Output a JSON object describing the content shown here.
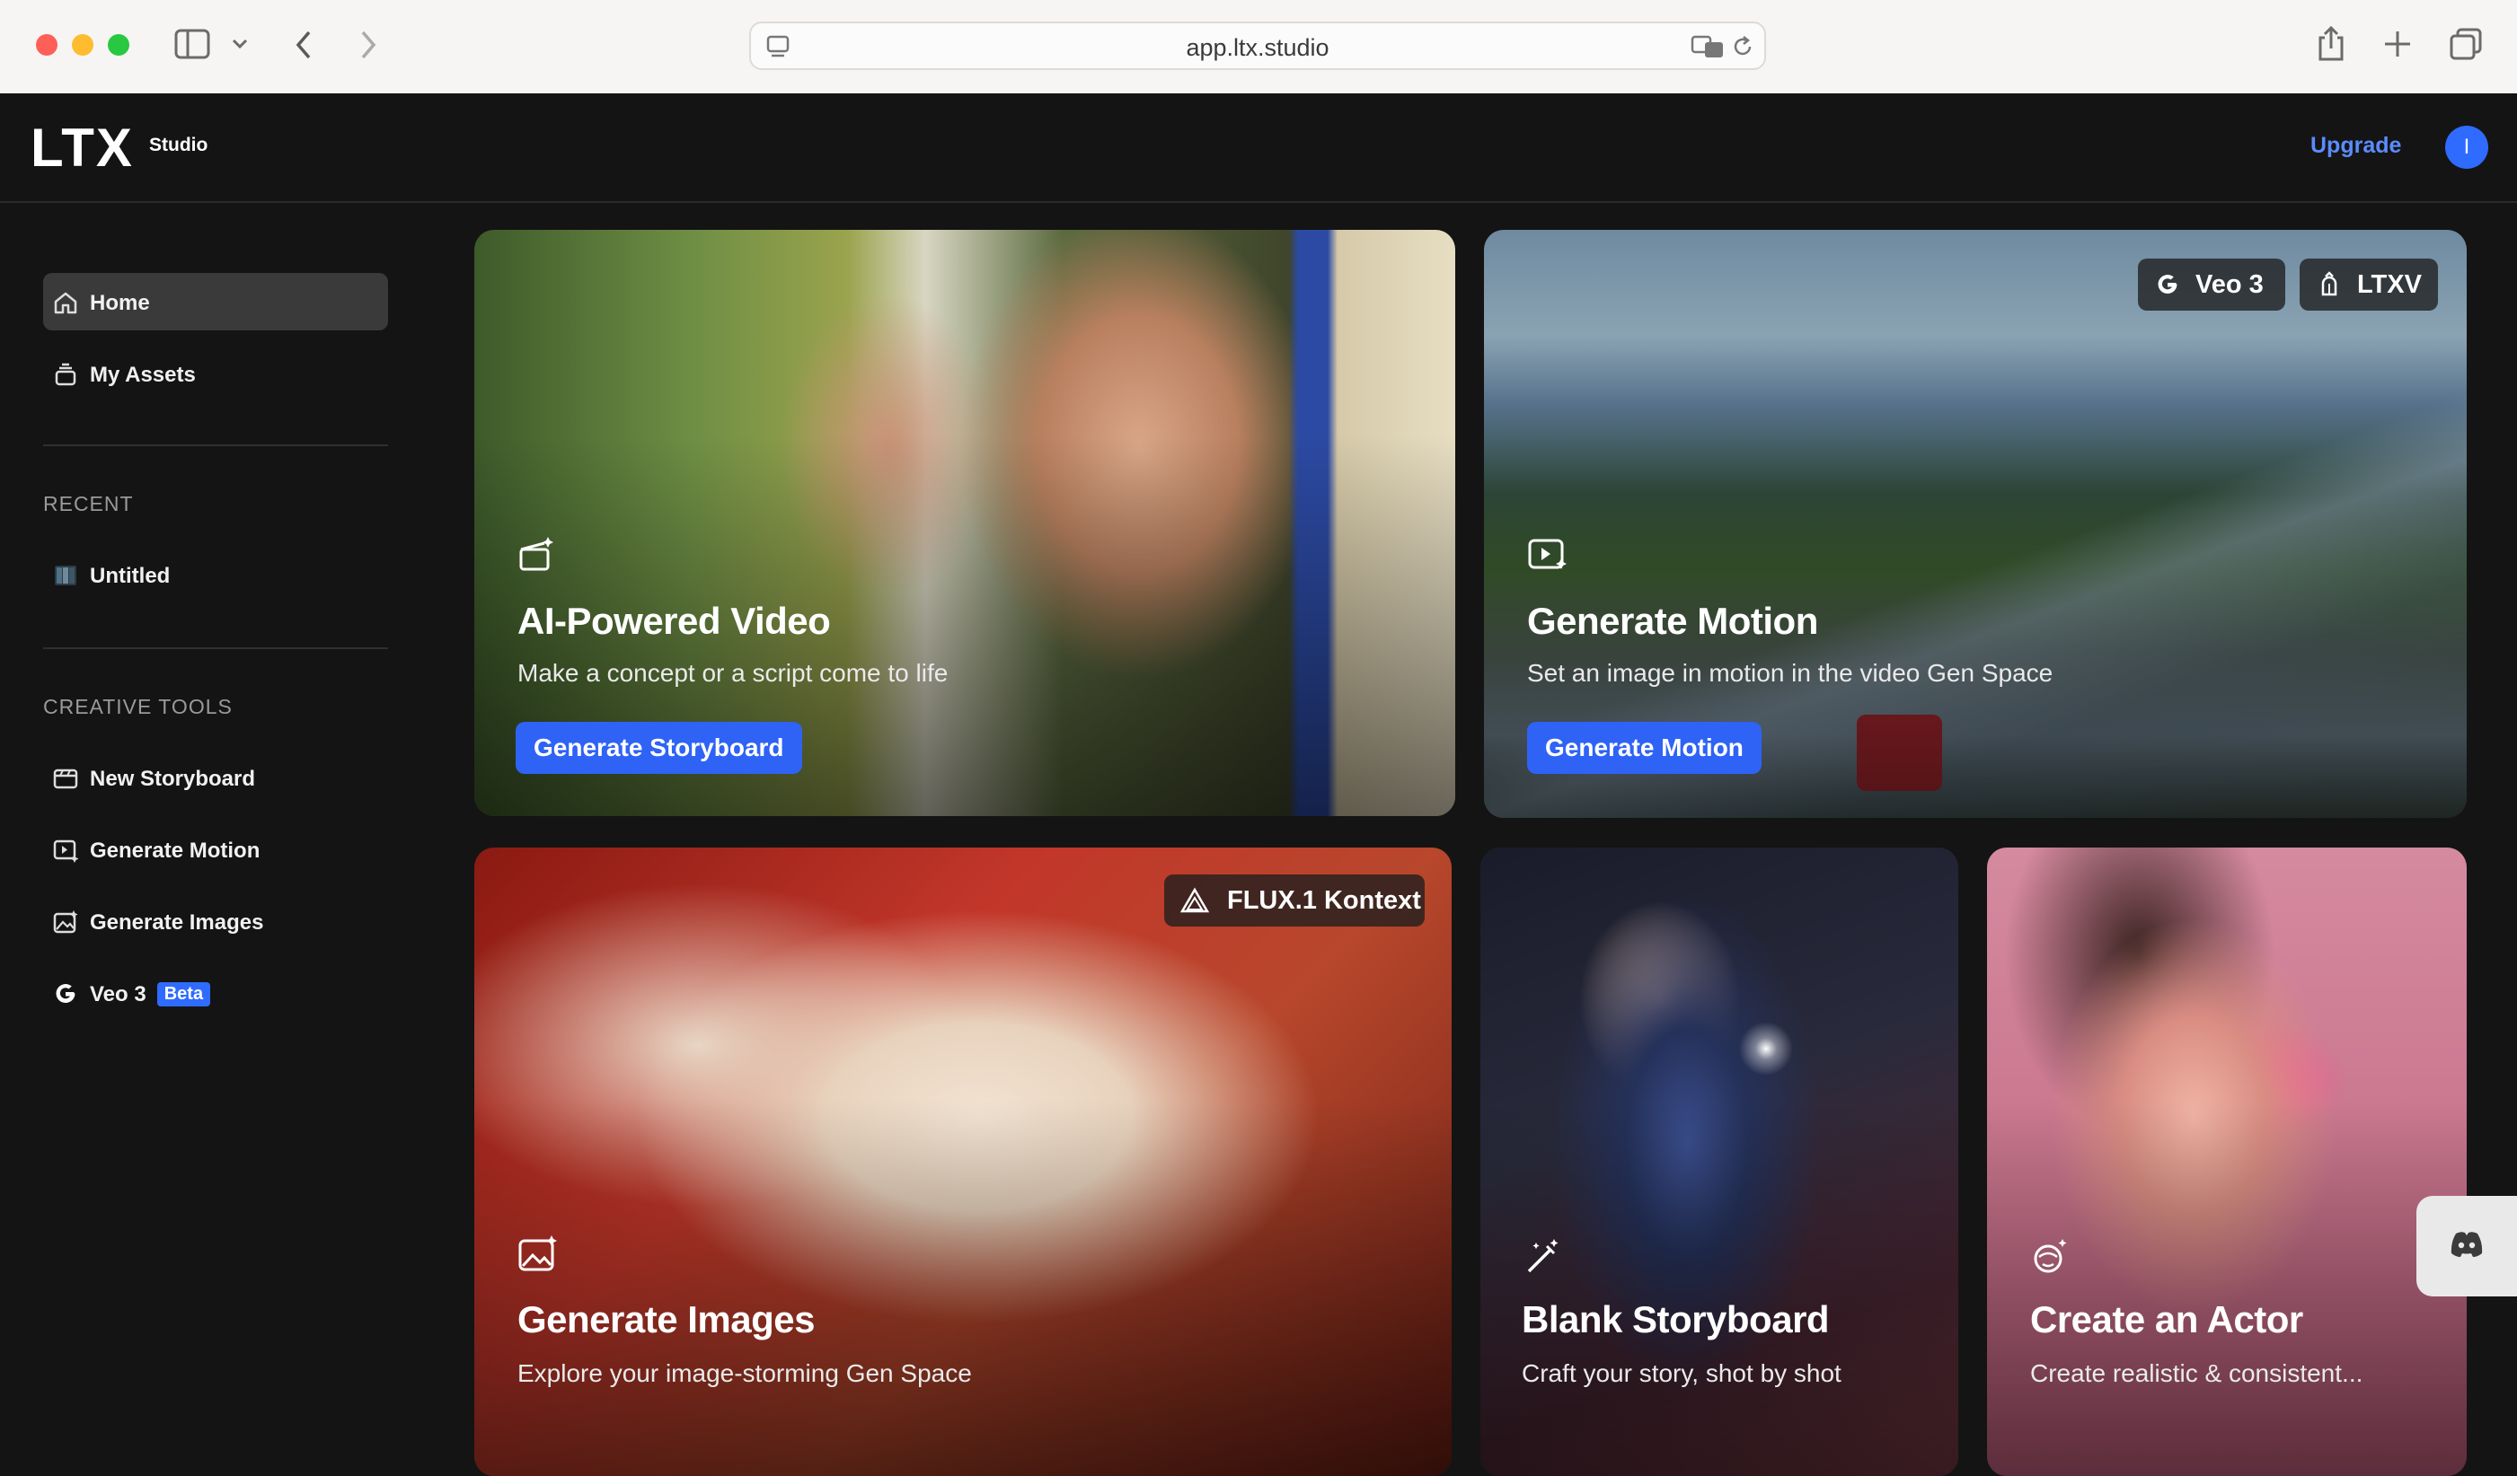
{
  "browser": {
    "url": "app.ltx.studio"
  },
  "header": {
    "logo_main": "LTX",
    "logo_sub": "Studio",
    "upgrade_label": "Upgrade",
    "avatar_initial": "I"
  },
  "sidebar": {
    "nav": [
      {
        "label": "Home",
        "icon": "home-icon",
        "active": true
      },
      {
        "label": "My Assets",
        "icon": "stack-icon"
      }
    ],
    "recent_title": "RECENT",
    "recent": [
      {
        "label": "Untitled",
        "icon": "storyboard-thumbnail"
      }
    ],
    "tools_title": "CREATIVE TOOLS",
    "tools": [
      {
        "label": "New Storyboard",
        "icon": "storyboard-icon"
      },
      {
        "label": "Generate Motion",
        "icon": "motion-icon"
      },
      {
        "label": "Generate Images",
        "icon": "image-sparkle-icon"
      },
      {
        "label": "Veo 3",
        "icon": "google-g-icon",
        "badge": "Beta"
      }
    ]
  },
  "cards": {
    "video": {
      "title": "AI-Powered Video",
      "subtitle": "Make a concept or a script come to life",
      "button": "Generate Storyboard"
    },
    "motion": {
      "title": "Generate Motion",
      "subtitle": "Set an image in motion in the video Gen Space",
      "button": "Generate Motion",
      "badges": [
        "Veo 3",
        "LTXV"
      ]
    },
    "images": {
      "title": "Generate Images",
      "subtitle": "Explore your image-storming Gen Space",
      "badge": "FLUX.1 Kontext"
    },
    "blank": {
      "title": "Blank Storyboard",
      "subtitle": "Craft your story, shot by shot"
    },
    "actor": {
      "title": "Create an Actor",
      "subtitle": "Create realistic & consistent..."
    }
  },
  "colors": {
    "accent": "#2f63f5",
    "upgrade": "#5b8cff",
    "app_bg": "#141414",
    "sidebar_active": "#3a3a3a"
  }
}
